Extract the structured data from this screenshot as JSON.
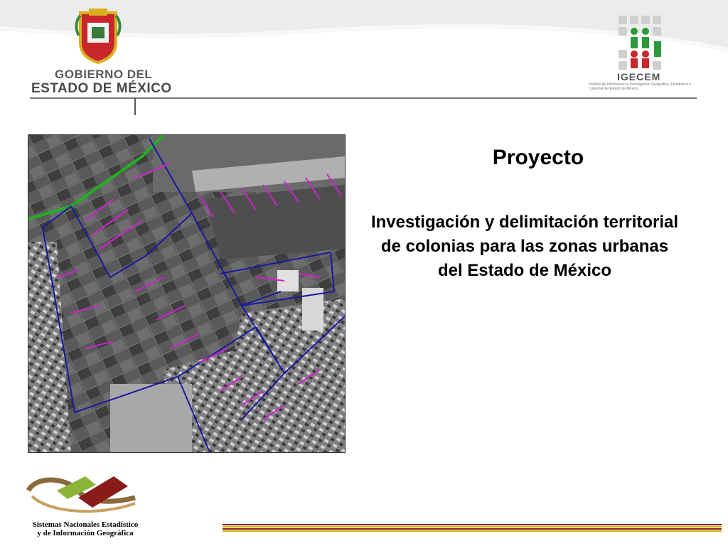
{
  "header": {
    "left_logo": {
      "line1": "GOBIERNO DEL",
      "line2": "ESTADO DE MÉXICO",
      "emblem": "coat-of-arms-icon"
    },
    "right_logo": {
      "name": "IGECEM",
      "subtitle": "Instituto de Información e Investigación Geográfica, Estadística y Catastral del Estado de México",
      "emblem": "grid-people-icon"
    }
  },
  "slide": {
    "title": "Proyecto",
    "body": "Investigación y delimitación territorial de  colonias para las zonas urbanas del Estado de México"
  },
  "map": {
    "description_icon": "aerial-map-icon",
    "colors": {
      "boundary": "#1a1aa0",
      "streets": "#d020d0",
      "edge": "#22b022"
    }
  },
  "footer": {
    "logo_line1": "Sistemas Nacionales Estadístico",
    "logo_line2": "y de Información Geográfica",
    "stripe_colors": [
      "#8b1a1a",
      "#c8b400",
      "#8b1a1a",
      "#c8b400"
    ]
  }
}
